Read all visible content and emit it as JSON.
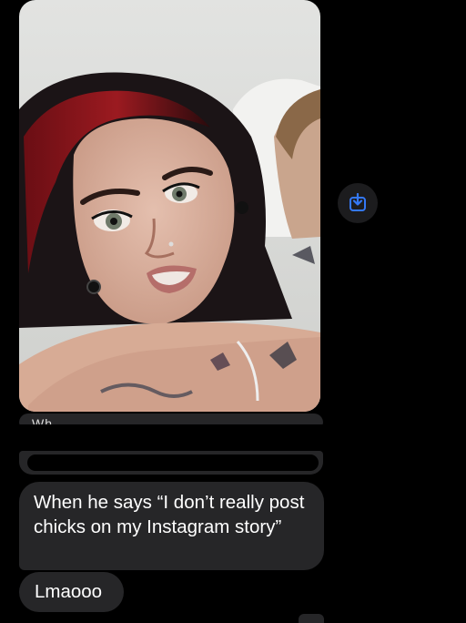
{
  "messages": {
    "photo_alt": "Selfie of two people lying in bed",
    "partial_text": "Wh",
    "bubble_main": "When he says “I don’t really post chicks on my Instagram story”",
    "bubble_reply": "Lmaooo"
  },
  "icons": {
    "save": "download-to-photos-icon"
  },
  "colors": {
    "bubble": "#262628",
    "background": "#000000",
    "accent": "#3478f6"
  }
}
